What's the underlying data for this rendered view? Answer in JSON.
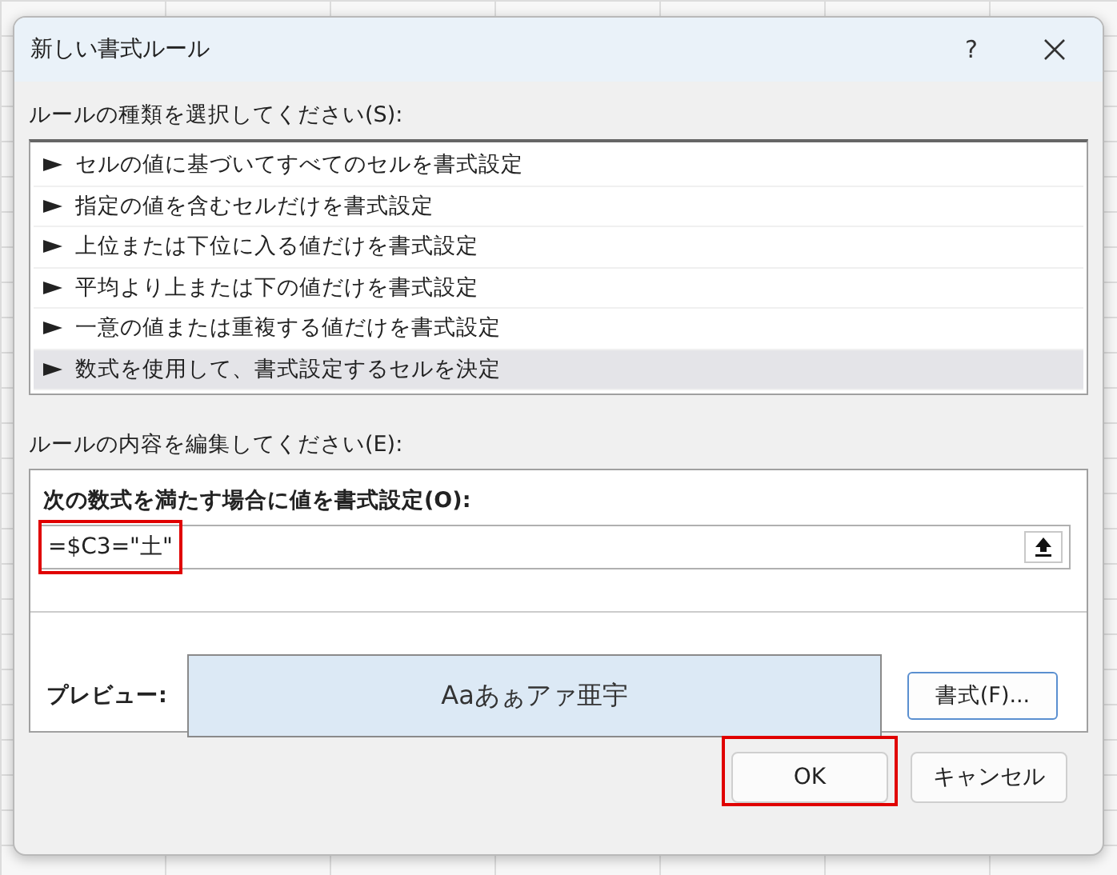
{
  "window": {
    "title": "新しい書式ルール",
    "help": "?"
  },
  "rule_type": {
    "label": "ルールの種類を選択してください(S):",
    "items": [
      {
        "label": "セルの値に基づいてすべてのセルを書式設定",
        "selected": false
      },
      {
        "label": "指定の値を含むセルだけを書式設定",
        "selected": false
      },
      {
        "label": "上位または下位に入る値だけを書式設定",
        "selected": false
      },
      {
        "label": "平均より上または下の値だけを書式設定",
        "selected": false
      },
      {
        "label": "一意の値または重複する値だけを書式設定",
        "selected": false
      },
      {
        "label": "数式を使用して、書式設定するセルを決定",
        "selected": true
      }
    ]
  },
  "rule_edit": {
    "label": "ルールの内容を編集してください(E):",
    "formula_label": "次の数式を満たす場合に値を書式設定(O):",
    "formula_value": "=$C3=\"土\"",
    "formula_highlighted": true,
    "preview_label": "プレビュー:",
    "preview_text": "Aaあぁアァ亜宇",
    "format_button": "書式(F)..."
  },
  "buttons": [
    {
      "label": "OK",
      "highlighted": true
    },
    {
      "label": "キャンセル",
      "highlighted": false
    }
  ]
}
